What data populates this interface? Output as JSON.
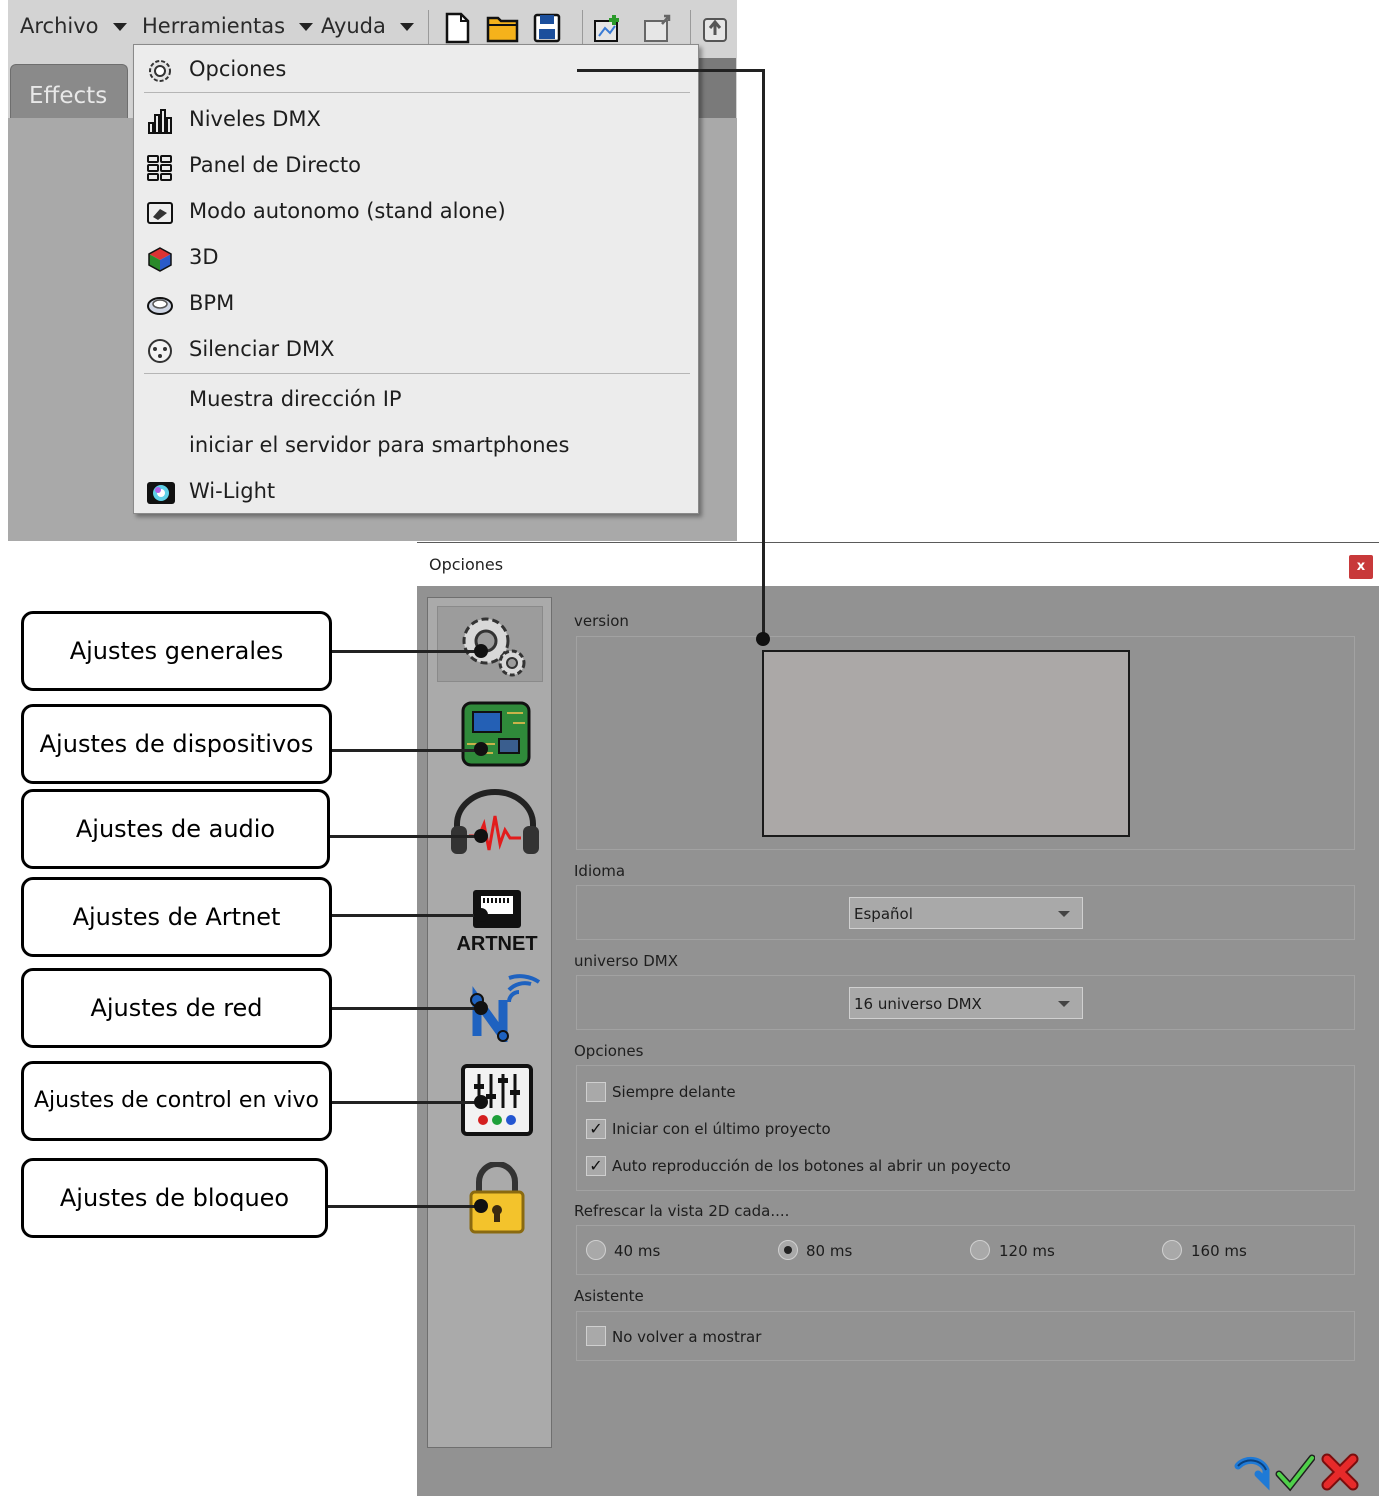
{
  "menubar": {
    "menus": [
      {
        "label": "Archivo"
      },
      {
        "label": "Herramientas"
      },
      {
        "label": "Ayuda"
      }
    ],
    "toolbar_icons": [
      "new-file-icon",
      "open-folder-icon",
      "save-icon",
      "import-icon",
      "export-icon",
      "upload-icon"
    ]
  },
  "tabs": {
    "effects": "Effects"
  },
  "dropdown": {
    "items": [
      {
        "label": "Opciones",
        "icon": "gear-icon"
      },
      {
        "label": "Niveles DMX",
        "icon": "bar-levels-icon"
      },
      {
        "label": "Panel de Directo",
        "icon": "live-panel-icon"
      },
      {
        "label": "Modo autonomo (stand alone)",
        "icon": "standalone-device-icon"
      },
      {
        "label": "3D",
        "icon": "cube-3d-icon"
      },
      {
        "label": "BPM",
        "icon": "bpm-icon"
      },
      {
        "label": "Silenciar DMX",
        "icon": "dmx-connector-icon"
      },
      {
        "label": "Muestra dirección IP",
        "icon": ""
      },
      {
        "label": "iniciar el servidor para smartphones",
        "icon": ""
      },
      {
        "label": "Wi-Light",
        "icon": "wi-light-icon"
      }
    ]
  },
  "dialog": {
    "title": "Opciones",
    "close": "x",
    "groups": {
      "version": "version",
      "idioma": "Idioma",
      "universo": "universo DMX",
      "opciones": "Opciones",
      "refresco": "Refrescar la vista 2D cada....",
      "asistente": "Asistente"
    },
    "idioma_value": "Español",
    "universo_value": "16 universo DMX",
    "checkboxes": [
      {
        "label": "Siempre delante",
        "checked": false
      },
      {
        "label": "Iniciar con el último proyecto",
        "checked": true
      },
      {
        "label": "Auto reproducción de los botones al abrir un poyecto",
        "checked": true
      }
    ],
    "check_mark": "✓",
    "refresh_options": [
      {
        "label": "40 ms",
        "selected": false
      },
      {
        "label": "80 ms",
        "selected": true
      },
      {
        "label": "120 ms",
        "selected": false
      },
      {
        "label": "160 ms",
        "selected": false
      }
    ],
    "asistente_checkbox": {
      "label": "No volver a mostrar",
      "checked": false
    },
    "artnet_icon_text": "ARTNET"
  },
  "callouts": [
    {
      "label": "Ajustes generales"
    },
    {
      "label": "Ajustes de dispositivos"
    },
    {
      "label": "Ajustes de audio"
    },
    {
      "label": "Ajustes de Artnet"
    },
    {
      "label": "Ajustes de red"
    },
    {
      "label": "Ajustes de control en vivo"
    },
    {
      "label": "Ajustes de bloqueo"
    }
  ],
  "colors": {
    "dialog_bg": "#929292",
    "close_red": "#c8393a",
    "menu_bg": "#ececec"
  }
}
